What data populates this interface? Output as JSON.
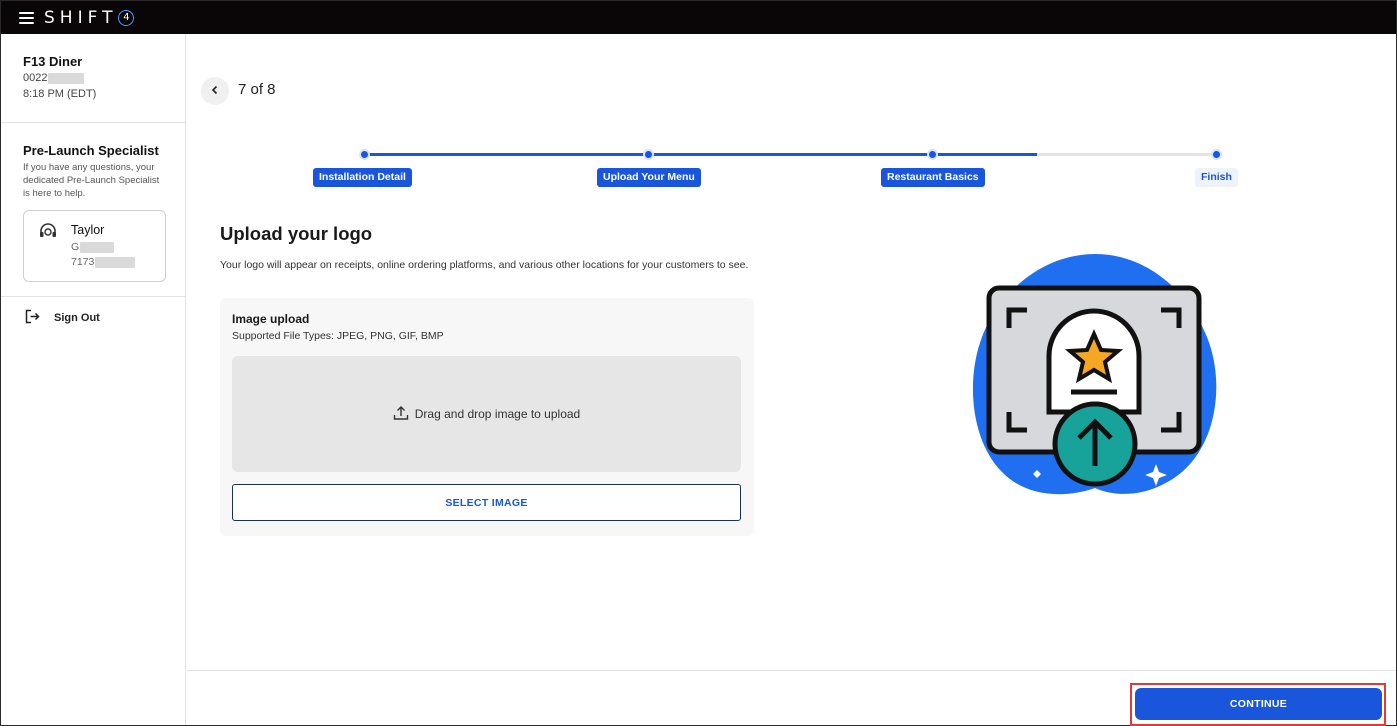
{
  "app": {
    "brand": "SHIFT",
    "brand_mark": "4"
  },
  "sidebar": {
    "store_name": "F13 Diner",
    "store_id_prefix": "0022",
    "store_time": "8:18 PM (EDT)",
    "specialist_title": "Pre-Launch Specialist",
    "specialist_desc": "If you have any questions, your dedicated Pre-Launch Specialist is here to help.",
    "specialist_name": "Taylor",
    "specialist_line1_prefix": "G",
    "specialist_line2_prefix": "7173",
    "signout_label": "Sign Out",
    "icons": [
      "hamburger-icon",
      "headset-icon",
      "sign-out-icon"
    ]
  },
  "main": {
    "step_count": "7 of 8",
    "stepper": {
      "steps": [
        {
          "label": "Installation Detail",
          "state": "done"
        },
        {
          "label": "Upload Your Menu",
          "state": "done"
        },
        {
          "label": "Restaurant Basics",
          "state": "done"
        },
        {
          "label": "Finish",
          "state": "todo"
        }
      ],
      "progress_fraction": 0.79
    },
    "title": "Upload your logo",
    "description": "Your logo will appear on receipts, online ordering platforms, and various other locations for your customers to see.",
    "upload": {
      "title": "Image upload",
      "types": "Supported File Types: JPEG, PNG, GIF, BMP",
      "dropzone_label": "Drag and drop image to upload",
      "select_label": "SELECT IMAGE"
    }
  },
  "footer": {
    "continue_label": "CONTINUE"
  },
  "colors": {
    "accent": "#1a56db",
    "topbar": "#0a0506",
    "highlight": "#e53935",
    "illustration_blob": "#1f6ff0",
    "illustration_teal": "#17a39a",
    "illustration_star": "#f5a623"
  }
}
